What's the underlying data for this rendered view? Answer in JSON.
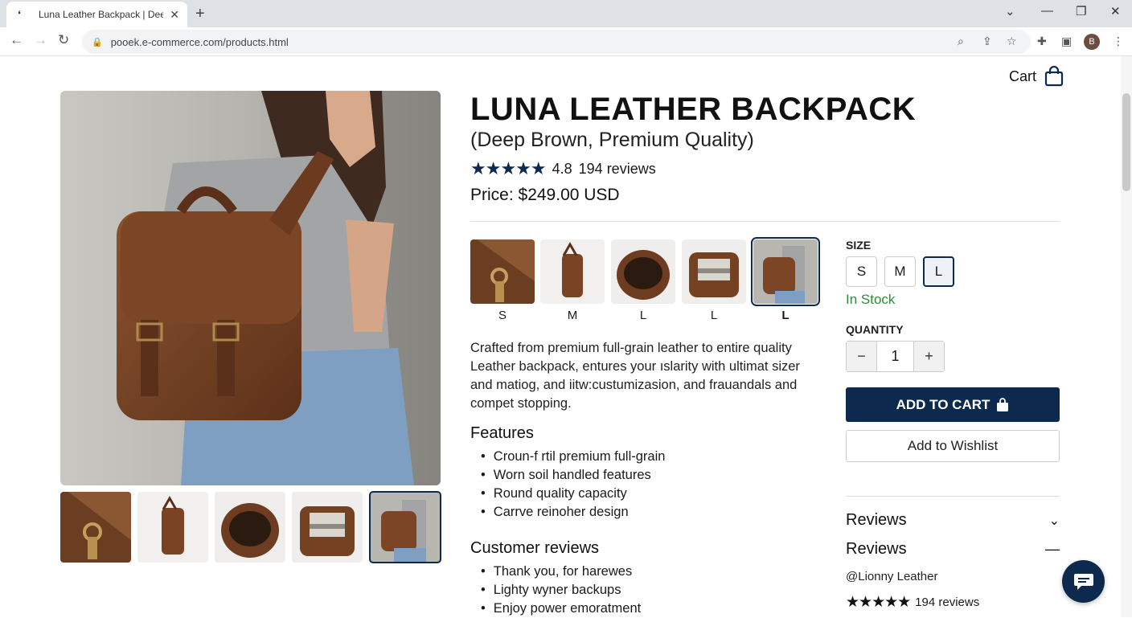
{
  "browser": {
    "tab_title": "Luna Leather Backpack | Deep",
    "url": "pooek.e-commerce.com/products.html",
    "profile_initial": "B"
  },
  "header": {
    "cart_label": "Cart"
  },
  "product": {
    "title": "LUNA LEATHER BACKPACK",
    "subtitle": "(Deep Brown, Premium Quality)",
    "rating_value": "4.8",
    "reviews_count": "194 reviews",
    "price": "Price: $249.00 USD",
    "variants": [
      {
        "label": "S",
        "selected": false
      },
      {
        "label": "M",
        "selected": false
      },
      {
        "label": "L",
        "selected": false
      },
      {
        "label": "L",
        "selected": false
      },
      {
        "label": "L",
        "selected": true
      }
    ],
    "description": "Crafted from premium full-grain leather to entire quality Leather backpack, entures your ıslarity with ultimat sizer and matiog, and iitw:custumizasion, and frauandals and compet stopping.",
    "features_heading": "Features",
    "features": [
      "Croun-f rtil premium full-grain",
      "Worn soil handled features",
      "Round quality capacity",
      "Carrve reinoher design"
    ],
    "customer_reviews_heading": "Customer reviews",
    "customer_reviews": [
      "Thank you, for harewes",
      "Lighty wyner backups",
      "Enjoy power emoratment"
    ]
  },
  "purchase": {
    "size_label": "SIZE",
    "sizes": [
      "S",
      "M",
      "L"
    ],
    "selected_size": "L",
    "stock_status": "In Stock",
    "stock_color": "#2f8a3a",
    "quantity_label": "QUANTITY",
    "quantity": "1",
    "minus": "−",
    "plus": "+",
    "add_to_cart": "ADD TO CART",
    "wishlist": "Add to Wishlist",
    "accent_color": "#0d2a4e"
  },
  "reviews_panel": {
    "heading_collapsed": "Reviews",
    "heading_expanded": "Reviews",
    "reviewer": "@Lionny Leather",
    "reviews_count": "194 reviews"
  }
}
